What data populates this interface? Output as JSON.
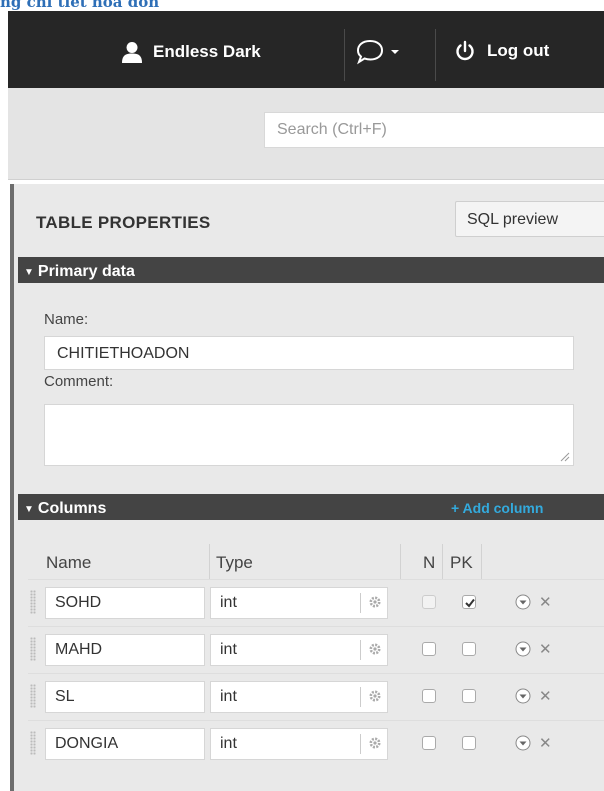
{
  "doc_heading": "ng chi tiet hoa don",
  "topbar": {
    "username": "Endless Dark",
    "logout_label": "Log out"
  },
  "search": {
    "placeholder": "Search (Ctrl+F)"
  },
  "table_properties": {
    "title": "TABLE PROPERTIES",
    "sql_preview_label": "SQL preview",
    "primary_data": {
      "section_label": "Primary data",
      "name_label": "Name:",
      "name_value": "CHITIETHOADON",
      "comment_label": "Comment:",
      "comment_value": ""
    },
    "columns": {
      "section_label": "Columns",
      "add_label": "+ Add column",
      "headers": {
        "name": "Name",
        "type": "Type",
        "n": "N",
        "pk": "PK"
      },
      "rows": [
        {
          "name": "SOHD",
          "type": "int",
          "n": false,
          "n_disabled": true,
          "pk": true
        },
        {
          "name": "MAHD",
          "type": "int",
          "n": false,
          "n_disabled": false,
          "pk": false
        },
        {
          "name": "SL",
          "type": "int",
          "n": false,
          "n_disabled": false,
          "pk": false
        },
        {
          "name": "DONGIA",
          "type": "int",
          "n": false,
          "n_disabled": false,
          "pk": false
        }
      ]
    }
  },
  "icons": {
    "user": "user-icon",
    "chat": "chat-bubble-icon",
    "power": "power-icon",
    "gear": "gear-icon",
    "row_menu": "chevron-circle-icon",
    "delete": "close-icon",
    "grip": "drag-grip-icon"
  },
  "colors": {
    "topbar_bg": "#262626",
    "section_bar_bg": "#444444",
    "accent_link": "#33aadd",
    "heading_blue": "#2e6fb7"
  }
}
